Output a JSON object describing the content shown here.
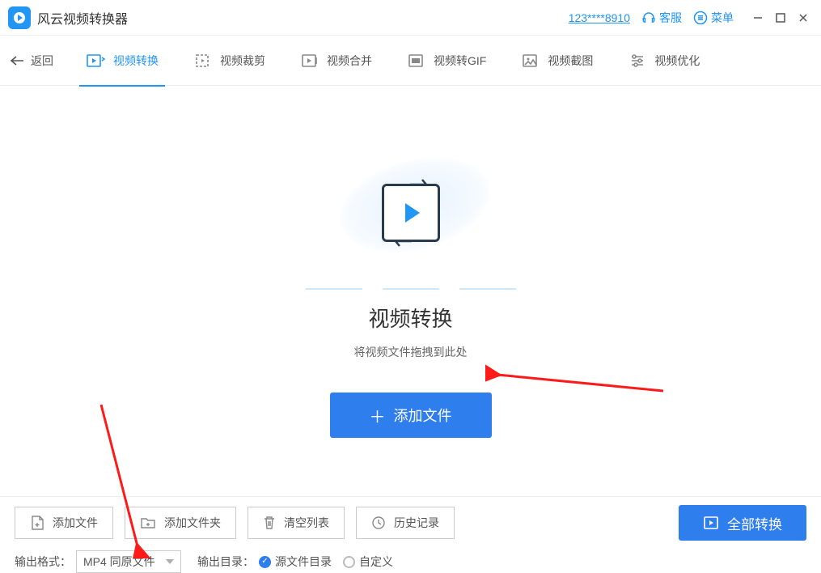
{
  "titlebar": {
    "app_name": "风云视频转换器",
    "phone": "123****8910",
    "support": "客服",
    "menu": "菜单"
  },
  "tabs": {
    "back": "返回",
    "items": [
      {
        "label": "视频转换",
        "active": true
      },
      {
        "label": "视频裁剪",
        "active": false
      },
      {
        "label": "视频合并",
        "active": false
      },
      {
        "label": "视频转GIF",
        "active": false
      },
      {
        "label": "视频截图",
        "active": false
      },
      {
        "label": "视频优化",
        "active": false
      }
    ]
  },
  "drop": {
    "title": "视频转换",
    "subtitle": "将视频文件拖拽到此处",
    "add_label": "添加文件"
  },
  "bottom": {
    "add_file": "添加文件",
    "add_folder": "添加文件夹",
    "clear_list": "清空列表",
    "history": "历史记录",
    "convert_all": "全部转换",
    "format_label": "输出格式：",
    "format_value": "MP4 同原文件",
    "outdir_label": "输出目录：",
    "radio_source": "源文件目录",
    "radio_custom": "自定义"
  }
}
